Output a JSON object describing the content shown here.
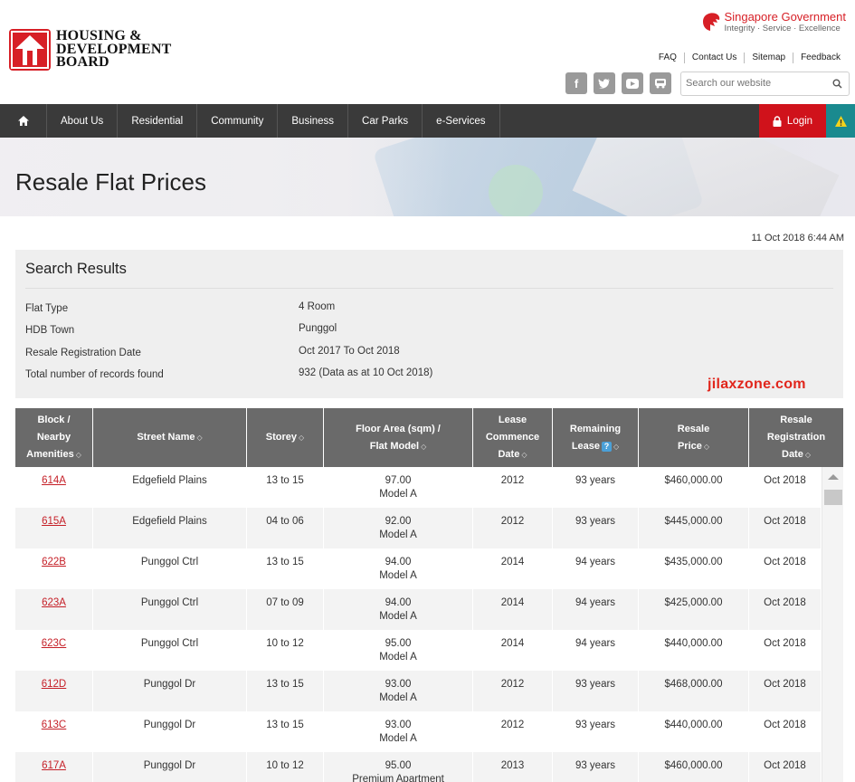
{
  "header": {
    "logo_lines": [
      "HOUSING &",
      "DEVELOPMENT",
      "BOARD"
    ],
    "gov_title_1": "Singapore",
    "gov_title_2": "Government",
    "gov_tagline": "Integrity · Service · Excellence",
    "top_links": [
      "FAQ",
      "Contact Us",
      "Sitemap",
      "Feedback"
    ],
    "social_icons": [
      "facebook-icon",
      "twitter-icon",
      "youtube-icon",
      "bus-icon"
    ],
    "search_placeholder": "Search our website"
  },
  "nav": {
    "items": [
      "About Us",
      "Residential",
      "Community",
      "Business",
      "Car Parks",
      "e-Services"
    ],
    "login_label": "Login"
  },
  "banner": {
    "title": "Resale Flat Prices"
  },
  "timestamp": "11 Oct 2018 6:44 AM",
  "results": {
    "heading": "Search Results",
    "rows": [
      {
        "label": "Flat Type",
        "value": "4 Room"
      },
      {
        "label": "HDB Town",
        "value": "Punggol"
      },
      {
        "label": "Resale Registration Date",
        "value": "Oct 2017 To Oct 2018"
      },
      {
        "label": "Total number of records found",
        "value": "932 (Data as at 10 Oct 2018)"
      }
    ]
  },
  "watermark": "jilaxzone.com",
  "table": {
    "headers": [
      {
        "l1": "Block /",
        "l2": "Nearby",
        "l3": "Amenities"
      },
      {
        "l1": "Street Name"
      },
      {
        "l1": "Storey"
      },
      {
        "l1": "Floor Area (sqm) /",
        "l2": "Flat Model"
      },
      {
        "l1": "Lease",
        "l2": "Commence",
        "l3": "Date"
      },
      {
        "l1": "Remaining",
        "l2": "Lease"
      },
      {
        "l1": "Resale",
        "l2": "Price"
      },
      {
        "l1": "Resale",
        "l2": "Registration",
        "l3": "Date"
      }
    ],
    "rows": [
      {
        "block": "614A",
        "street": "Edgefield Plains",
        "storey": "13 to 15",
        "area": "97.00",
        "model": "Model A",
        "lease": "2012",
        "remaining": "93 years",
        "price": "$460,000.00",
        "reg": "Oct 2018"
      },
      {
        "block": "615A",
        "street": "Edgefield Plains",
        "storey": "04 to 06",
        "area": "92.00",
        "model": "Model A",
        "lease": "2012",
        "remaining": "93 years",
        "price": "$445,000.00",
        "reg": "Oct 2018"
      },
      {
        "block": "622B",
        "street": "Punggol Ctrl",
        "storey": "13 to 15",
        "area": "94.00",
        "model": "Model A",
        "lease": "2014",
        "remaining": "94 years",
        "price": "$435,000.00",
        "reg": "Oct 2018"
      },
      {
        "block": "623A",
        "street": "Punggol Ctrl",
        "storey": "07 to 09",
        "area": "94.00",
        "model": "Model A",
        "lease": "2014",
        "remaining": "94 years",
        "price": "$425,000.00",
        "reg": "Oct 2018"
      },
      {
        "block": "623C",
        "street": "Punggol Ctrl",
        "storey": "10 to 12",
        "area": "95.00",
        "model": "Model A",
        "lease": "2014",
        "remaining": "94 years",
        "price": "$440,000.00",
        "reg": "Oct 2018"
      },
      {
        "block": "612D",
        "street": "Punggol Dr",
        "storey": "13 to 15",
        "area": "93.00",
        "model": "Model A",
        "lease": "2012",
        "remaining": "93 years",
        "price": "$468,000.00",
        "reg": "Oct 2018"
      },
      {
        "block": "613C",
        "street": "Punggol Dr",
        "storey": "13 to 15",
        "area": "93.00",
        "model": "Model A",
        "lease": "2012",
        "remaining": "93 years",
        "price": "$440,000.00",
        "reg": "Oct 2018"
      },
      {
        "block": "617A",
        "street": "Punggol Dr",
        "storey": "10 to 12",
        "area": "95.00",
        "model": "Premium Apartment",
        "lease": "2013",
        "remaining": "93 years",
        "price": "$460,000.00",
        "reg": "Oct 2018"
      }
    ]
  }
}
